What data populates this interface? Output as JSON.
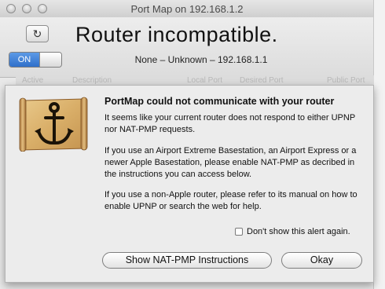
{
  "window": {
    "title": "Port Map on 192.168.1.2"
  },
  "header": {
    "toggle_label": "ON",
    "status_title": "Router incompatible.",
    "status_subtitle": "None – Unknown – 192.168.1.1"
  },
  "background": {
    "columns": [
      "Active",
      "Description",
      "Local Port",
      "Desired Port",
      "Public Port"
    ],
    "add_button": "+",
    "remove_button": "–"
  },
  "alert": {
    "heading": "PortMap could not communicate with your router",
    "paragraphs": [
      "It seems like your current router does not respond to either UPNP nor NAT-PMP requests.",
      "If you use an Airport Extreme Basestation, an Airport Express or a newer Apple Basestation, please enable NAT-PMP as decribed in the instructions you can access below.",
      "If you use a non-Apple router, please refer to its manual on how to enable UPNP or search the web for help."
    ],
    "checkbox_label": "Don't show this alert again.",
    "checkbox_checked": false,
    "secondary_button": "Show NAT-PMP Instructions",
    "primary_button": "Okay",
    "icon": "scroll-anchor-icon"
  }
}
